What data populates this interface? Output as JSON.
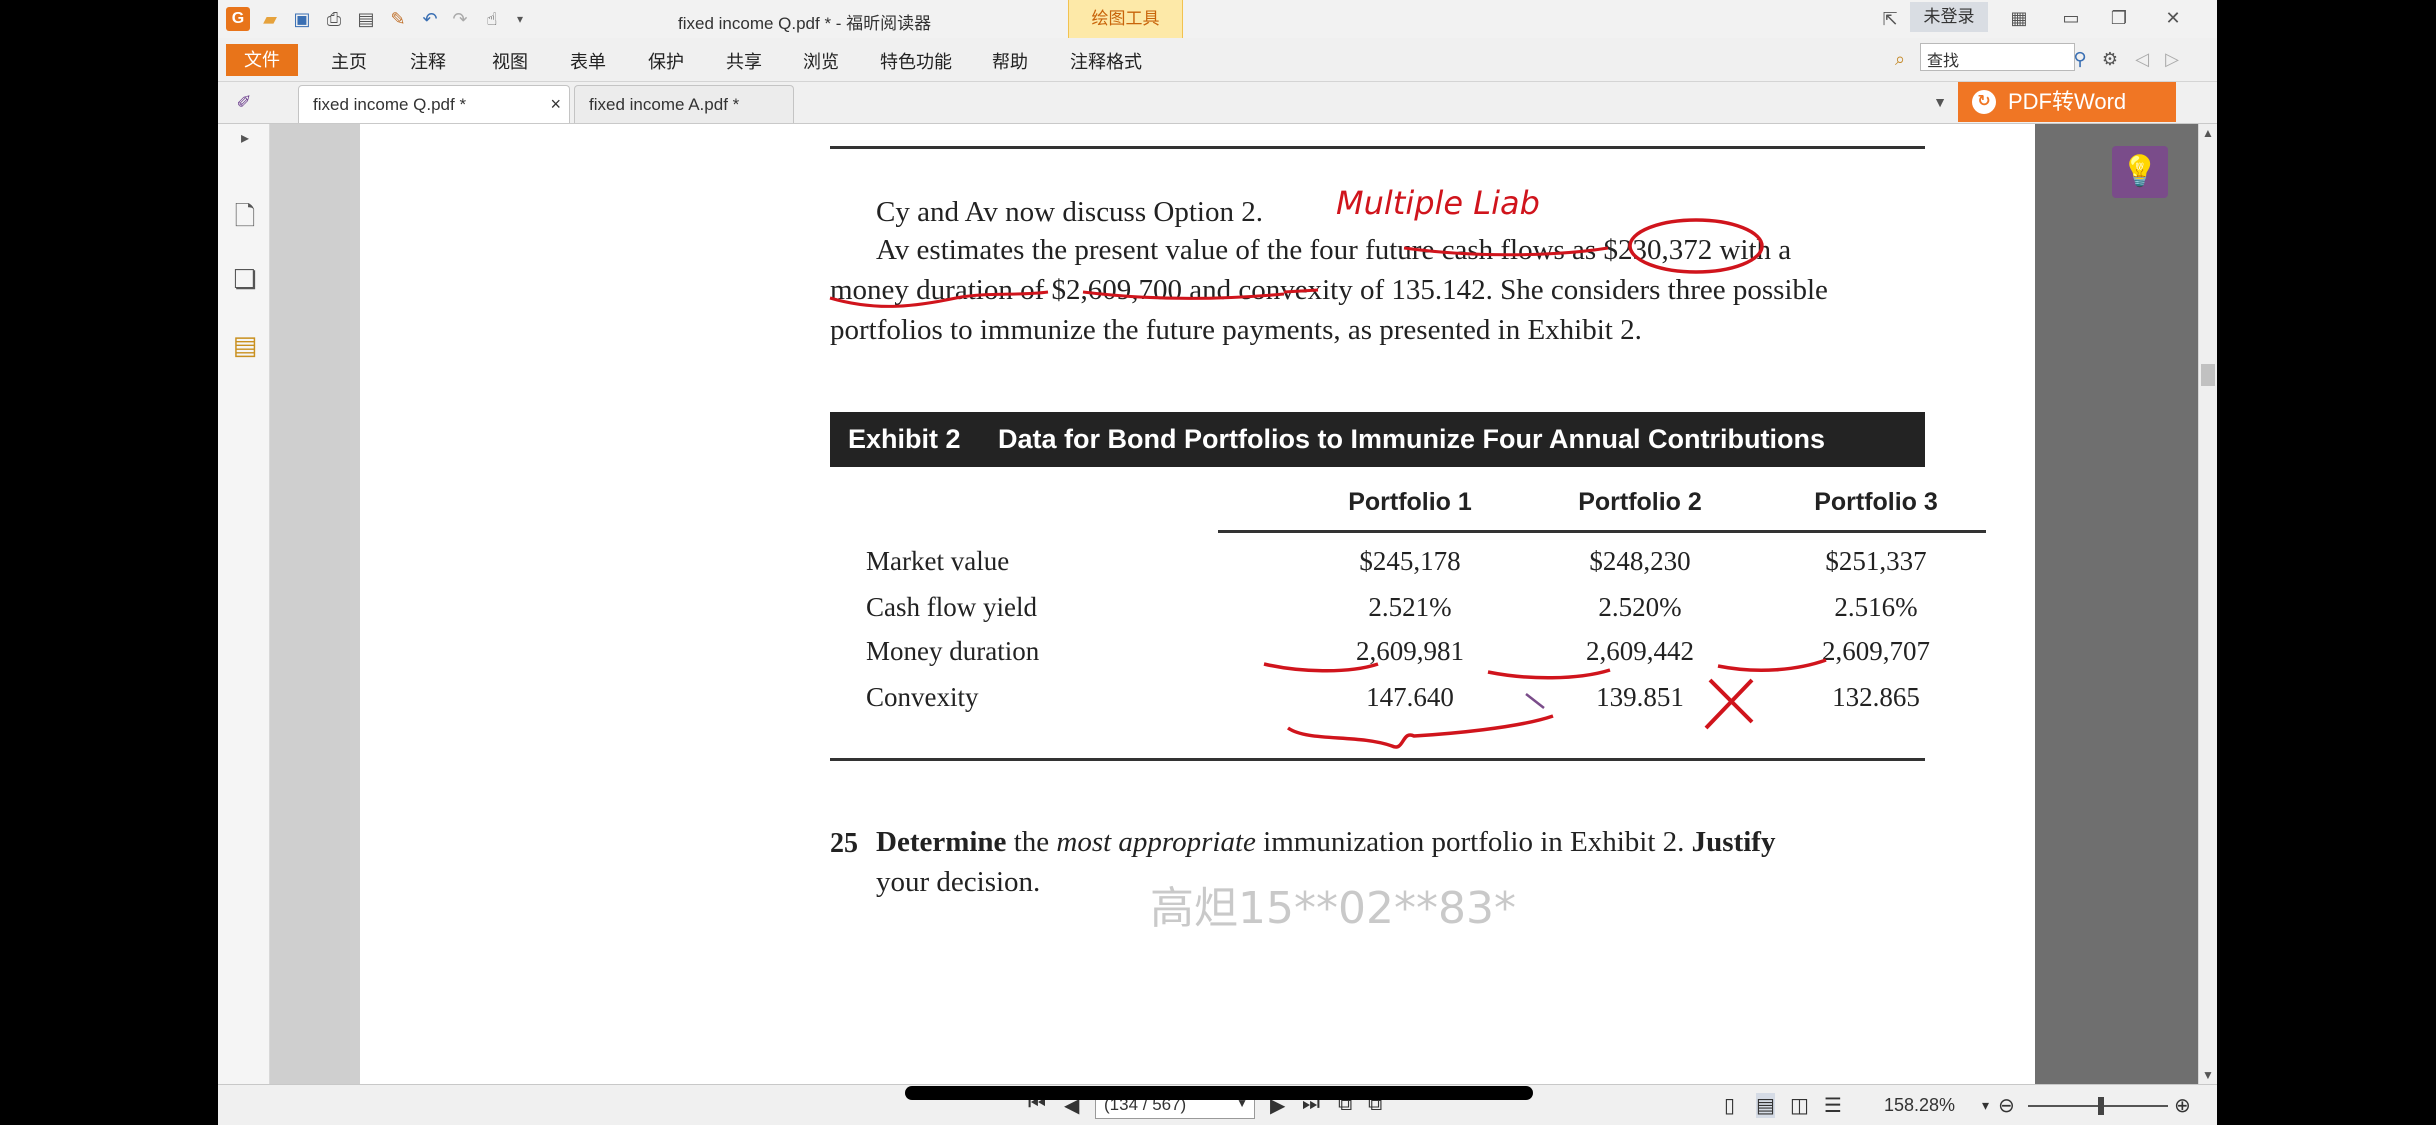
{
  "titlebar": {
    "window_title": "fixed income Q.pdf * - 福昕阅读器",
    "drawing_tools": "绘图工具",
    "login": "未登录"
  },
  "menubar": {
    "file": "文件",
    "items": [
      "主页",
      "注释",
      "视图",
      "表单",
      "保护",
      "共享",
      "浏览",
      "特色功能",
      "帮助",
      "注释格式"
    ],
    "search_placeholder": "查找"
  },
  "tabs": [
    {
      "label": "fixed income Q.pdf *",
      "close": "×"
    },
    {
      "label": "fixed income A.pdf *"
    }
  ],
  "pdf_to_word": "PDF转Word",
  "document": {
    "para1": "Cy and Av now discuss Option 2.",
    "para2_line1": "Av estimates the present value of the four future cash flows as $230,372 with a",
    "para2_line2": "money duration of $2,609,700 and convexity of 135.142. She considers three possible",
    "para2_line3": "portfolios to immunize the future payments, as presented in Exhibit 2.",
    "exhibit_title": "Exhibit 2     Data for Bond Portfolios to Immunize Four Annual Contributions",
    "table": {
      "columns": [
        "Portfolio 1",
        "Portfolio 2",
        "Portfolio 3"
      ],
      "rows": [
        {
          "label": "Market value",
          "values": [
            "$245,178",
            "$248,230",
            "$251,337"
          ]
        },
        {
          "label": "Cash flow yield",
          "values": [
            "2.521%",
            "2.520%",
            "2.516%"
          ]
        },
        {
          "label": "Money duration",
          "values": [
            "2,609,981",
            "2,609,442",
            "2,609,707"
          ]
        },
        {
          "label": "Convexity",
          "values": [
            "147.640",
            "139.851",
            "132.865"
          ]
        }
      ]
    },
    "question_number": "25",
    "question_line1_bold1": "Determine",
    "question_line1_mid1": " the ",
    "question_line1_ital": "most appropriate",
    "question_line1_mid2": " immunization portfolio in Exhibit 2. ",
    "question_line1_bold2": "Justify",
    "question_line2": "your decision.",
    "handwritten_note": "Multiple Liab",
    "watermark": "高炟15**02**83*"
  },
  "statusbar": {
    "page_indicator": "(134 / 567)",
    "zoom": "158.28%"
  }
}
